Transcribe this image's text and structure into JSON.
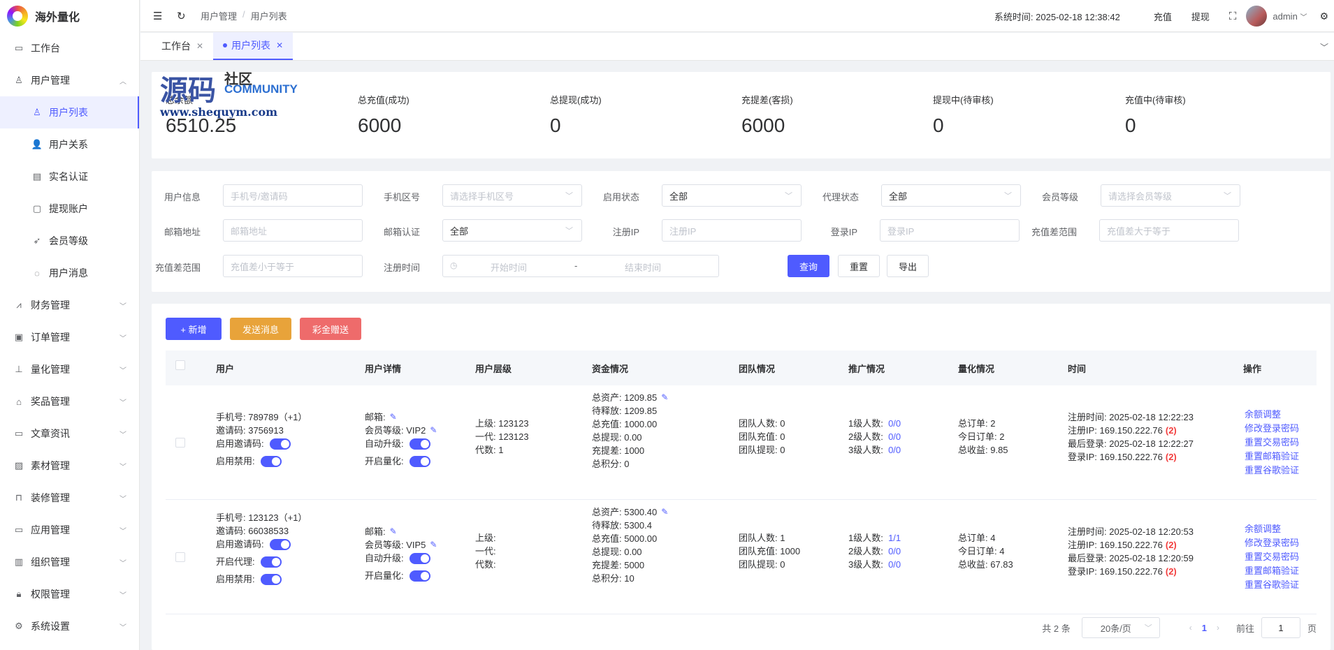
{
  "app": {
    "title": "海外量化"
  },
  "sidebar": {
    "items": [
      {
        "label": "工作台",
        "icon": "monitor-icon"
      },
      {
        "label": "用户管理",
        "icon": "user-icon",
        "expanded": true
      },
      {
        "label": "财务管理",
        "icon": "chart-icon"
      },
      {
        "label": "订单管理",
        "icon": "order-icon"
      },
      {
        "label": "量化管理",
        "icon": "tools-icon"
      },
      {
        "label": "奖品管理",
        "icon": "bag-icon"
      },
      {
        "label": "文章资讯",
        "icon": "message-icon"
      },
      {
        "label": "素材管理",
        "icon": "image-icon"
      },
      {
        "label": "装修管理",
        "icon": "sofa-icon"
      },
      {
        "label": "应用管理",
        "icon": "app-icon"
      },
      {
        "label": "组织管理",
        "icon": "building-icon"
      },
      {
        "label": "权限管理",
        "icon": "lock-icon"
      },
      {
        "label": "系统设置",
        "icon": "gear-icon"
      }
    ],
    "sub_items": [
      {
        "label": "用户列表",
        "icon": "user-icon",
        "active": true
      },
      {
        "label": "用户关系",
        "icon": "users-icon"
      },
      {
        "label": "实名认证",
        "icon": "id-card-icon"
      },
      {
        "label": "提现账户",
        "icon": "folder-icon"
      },
      {
        "label": "会员等级",
        "icon": "rocket-icon"
      },
      {
        "label": "用户消息",
        "icon": "chat-icon"
      }
    ]
  },
  "header": {
    "breadcrumb": [
      "用户管理",
      "/",
      "用户列表"
    ],
    "system_time": "系统时间: 2025-02-18 12:38:42",
    "recharge": "充值",
    "withdraw": "提现",
    "user": "admin"
  },
  "tabs": [
    {
      "label": "工作台",
      "active": false
    },
    {
      "label": "用户列表",
      "active": true
    }
  ],
  "watermark": {
    "big": "源码",
    "cn": "社区",
    "en": "COMMUNITY",
    "url": "www.shequym.com"
  },
  "stats": [
    {
      "label": "总余额",
      "value": "6510.25"
    },
    {
      "label": "总充值(成功)",
      "value": "6000"
    },
    {
      "label": "总提现(成功)",
      "value": "0"
    },
    {
      "label": "充提差(客损)",
      "value": "6000"
    },
    {
      "label": "提现中(待审核)",
      "value": "0"
    },
    {
      "label": "充值中(待审核)",
      "value": "0"
    }
  ],
  "filters": {
    "user_info": {
      "label": "用户信息",
      "placeholder": "手机号/邀请码"
    },
    "phone_area": {
      "label": "手机区号",
      "placeholder": "请选择手机区号"
    },
    "enable_status": {
      "label": "启用状态",
      "value": "全部"
    },
    "agent_status": {
      "label": "代理状态",
      "value": "全部"
    },
    "member_level": {
      "label": "会员等级",
      "placeholder": "请选择会员等级"
    },
    "email": {
      "label": "邮箱地址",
      "placeholder": "邮箱地址"
    },
    "email_verify": {
      "label": "邮箱认证",
      "value": "全部"
    },
    "reg_ip": {
      "label": "注册IP",
      "placeholder": "注册IP"
    },
    "login_ip": {
      "label": "登录IP",
      "placeholder": "登录IP"
    },
    "diff_min": {
      "label": "充值差范围",
      "placeholder": "充值差大于等于"
    },
    "diff_max": {
      "label": "充值差范围",
      "placeholder": "充值差小于等于"
    },
    "reg_time": {
      "label": "注册时间",
      "start": "开始时间",
      "sep": "-",
      "end": "结束时间"
    },
    "btn_query": "查询",
    "btn_reset": "重置",
    "btn_export": "导出"
  },
  "toolbar": {
    "add": "+ 新增",
    "add_color": "#4f5bff",
    "send": "发送消息",
    "send_color": "#e8a33a",
    "gift": "彩金赠送",
    "gift_color": "#ee6b6b"
  },
  "table": {
    "headers": [
      "用户",
      "用户详情",
      "用户层级",
      "资金情况",
      "团队情况",
      "推广情况",
      "量化情况",
      "时间",
      "操作"
    ],
    "rows": [
      {
        "user": {
          "phone": "手机号: 789789（+1）",
          "invite": "邀请码: 3756913",
          "toggles": [
            "启用邀请码:",
            "启用禁用:"
          ]
        },
        "detail": {
          "email": "邮箱:",
          "level": "会员等级: VIP2",
          "auto_up": "自动升级:",
          "quant": "开启量化:"
        },
        "hierarchy": {
          "up": "上级: 123123",
          "gen1": "一代: 123123",
          "gen": "代数: 1"
        },
        "funds": {
          "total": "总资产: 1209.85",
          "pending": "待释放: 1209.85",
          "recharge": "总充值: 1000.00",
          "withdraw": "总提现: 0.00",
          "diff": "充提差:  1000",
          "points": "总积分: 0"
        },
        "team": {
          "count": "团队人数: 0",
          "recharge": "团队充值: 0",
          "withdraw": "团队提现: 0"
        },
        "promo": [
          {
            "label": "1级人数:",
            "val": "0/0"
          },
          {
            "label": "2级人数:",
            "val": "0/0"
          },
          {
            "label": "3级人数:",
            "val": "0/0"
          }
        ],
        "quant": {
          "orders": "总订单: 2",
          "today": "今日订单: 2",
          "profit": "总收益: 9.85"
        },
        "time": {
          "reg_time": "注册时间: 2025-02-18 12:22:23",
          "reg_ip": "注册IP: 169.150.222.76",
          "reg_ip_count": "(2)",
          "last_login": "最后登录: 2025-02-18 12:22:27",
          "login_ip": "登录IP: 169.150.222.76",
          "login_ip_count": "(2)"
        },
        "ops": [
          "余额调整",
          "修改登录密码",
          "重置交易密码",
          "重置邮箱验证",
          "重置谷歌验证"
        ]
      },
      {
        "user": {
          "phone": "手机号: 123123（+1）",
          "invite": "邀请码: 66038533",
          "toggles": [
            "启用邀请码:",
            "开启代理:",
            "启用禁用:"
          ]
        },
        "detail": {
          "email": "邮箱:",
          "level": "会员等级: VIP5",
          "auto_up": "自动升级:",
          "quant": "开启量化:"
        },
        "hierarchy": {
          "up": "上级:",
          "gen1": "一代:",
          "gen": "代数:"
        },
        "funds": {
          "total": "总资产: 5300.40",
          "pending": "待释放: 5300.4",
          "recharge": "总充值: 5000.00",
          "withdraw": "总提现: 0.00",
          "diff": "充提差:  5000",
          "points": "总积分: 10"
        },
        "team": {
          "count": "团队人数: 1",
          "recharge": "团队充值: 1000",
          "withdraw": "团队提现: 0"
        },
        "promo": [
          {
            "label": "1级人数:",
            "val": "1/1"
          },
          {
            "label": "2级人数:",
            "val": "0/0"
          },
          {
            "label": "3级人数:",
            "val": "0/0"
          }
        ],
        "quant": {
          "orders": "总订单: 4",
          "today": "今日订单: 4",
          "profit": "总收益: 67.83"
        },
        "time": {
          "reg_time": "注册时间: 2025-02-18 12:20:53",
          "reg_ip": "注册IP: 169.150.222.76",
          "reg_ip_count": "(2)",
          "last_login": "最后登录: 2025-02-18 12:20:59",
          "login_ip": "登录IP: 169.150.222.76",
          "login_ip_count": "(2)"
        },
        "ops": [
          "余额调整",
          "修改登录密码",
          "重置交易密码",
          "重置邮箱验证",
          "重置谷歌验证"
        ]
      }
    ]
  },
  "pagination": {
    "total": "共 2 条",
    "size": "20条/页",
    "page": "1",
    "goto": "前往",
    "input": "1",
    "suffix": "页"
  }
}
